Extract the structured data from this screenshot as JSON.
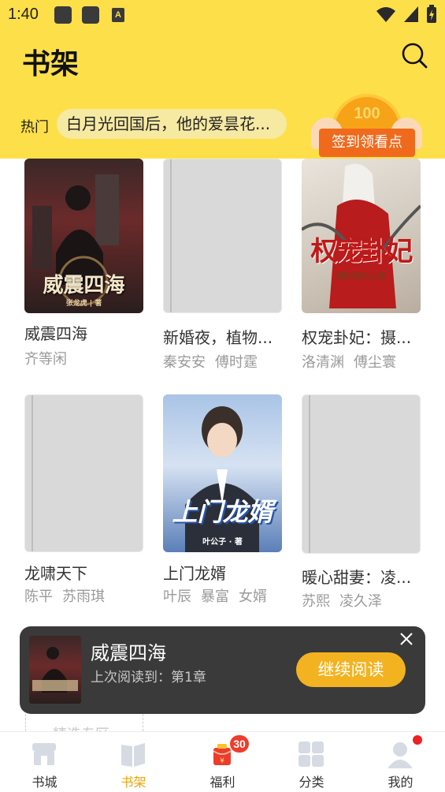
{
  "status_bar": {
    "time": "1:40",
    "notification_letter": "A"
  },
  "header": {
    "title": "书架",
    "hot_label": "热门",
    "hot_search_text": "白月光回国后，他的爱昙花...",
    "signin": {
      "coin_text": "100",
      "label": "签到领看点"
    }
  },
  "books": [
    {
      "title": "威震四海",
      "tags": [
        "齐等闲"
      ],
      "cover_text": "威震四海",
      "cover_author": "张龙虎 | 著"
    },
    {
      "title": "新婚夜，植物...",
      "tags": [
        "秦安安",
        "傅时霆"
      ]
    },
    {
      "title": "权宠卦妃：摄...",
      "tags": [
        "洛清渊",
        "傅尘寰"
      ],
      "cover_text": "权宠卦妃",
      "cover_sub": "摄政王的心上娇"
    },
    {
      "title": "龙啸天下",
      "tags": [
        "陈平",
        "苏雨琪"
      ]
    },
    {
      "title": "上门龙婿",
      "tags": [
        "叶辰",
        "暴富",
        "女婿"
      ],
      "cover_text": "上门龙婿",
      "cover_author": "叶公子 · 著"
    },
    {
      "title": "暖心甜妻：凌...",
      "tags": [
        "苏熙",
        "凌久泽"
      ]
    }
  ],
  "continue_reading": {
    "title": "威震四海",
    "progress": "上次阅读到：第1章",
    "button": "继续阅读"
  },
  "recommend_hint": "精选专区",
  "bottom_nav": [
    {
      "label": "书城",
      "icon": "store-icon"
    },
    {
      "label": "书架",
      "icon": "bookshelf-icon",
      "active": true
    },
    {
      "label": "福利",
      "icon": "red-envelope-icon",
      "badge": "30"
    },
    {
      "label": "分类",
      "icon": "category-grid-icon"
    },
    {
      "label": "我的",
      "icon": "profile-icon",
      "dot": true
    }
  ],
  "colors": {
    "header_bg": "#fddf4a",
    "accent": "#f0a30a",
    "continue_button": "#f3b21f",
    "badge": "#ee3b2b"
  }
}
